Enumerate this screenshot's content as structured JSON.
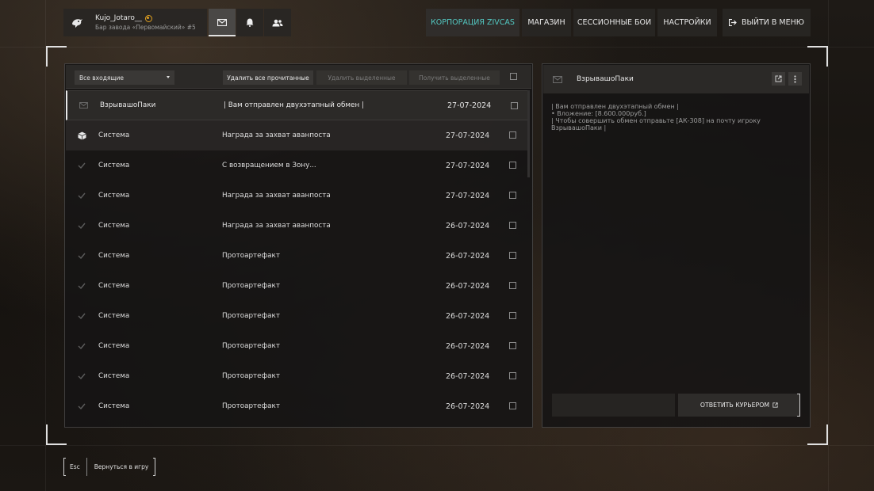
{
  "profile": {
    "name": "Kujo_Jotaro__",
    "subtitle": "Бар завода «Первомайский» #5",
    "avatar_icon": "bird-avatar-icon",
    "badge_icon": "rank-badge-icon",
    "badge_color": "#e0a020"
  },
  "top_icons": [
    {
      "name": "mail-icon",
      "active": true
    },
    {
      "name": "bell-icon",
      "active": false
    },
    {
      "name": "friends-icon",
      "active": false
    }
  ],
  "nav": {
    "corporation": "КОРПОРАЦИЯ ZIVCAS",
    "shop": "МАГАЗИН",
    "session_battles": "СЕССИОННЫЕ БОИ",
    "settings": "НАСТРОЙКИ",
    "exit": "ВЫЙТИ В МЕНЮ"
  },
  "accent_color": "#53c8c2",
  "toolbar": {
    "filter_selected": "Все входящие",
    "delete_read": "Удалить все прочитанные",
    "delete_selected": "Удалить выделенные",
    "receive_selected": "Получить выделенные"
  },
  "messages": [
    {
      "sender": "ВзрывашоПаки",
      "subject": "| Вам отправлен двухэтапный обмен |",
      "date": "27-07-2024",
      "icon": "envelope-icon",
      "state": "selected"
    },
    {
      "sender": "Система",
      "subject": "Награда за захват аванпоста",
      "date": "27-07-2024",
      "icon": "package-icon",
      "state": "unread"
    },
    {
      "sender": "Система",
      "subject": "С возвращением в Зону...",
      "date": "27-07-2024",
      "icon": "check-icon",
      "state": "read"
    },
    {
      "sender": "Система",
      "subject": "Награда за захват аванпоста",
      "date": "27-07-2024",
      "icon": "check-icon",
      "state": "read"
    },
    {
      "sender": "Система",
      "subject": "Награда за захват аванпоста",
      "date": "26-07-2024",
      "icon": "check-icon",
      "state": "read"
    },
    {
      "sender": "Система",
      "subject": "Протоартефакт",
      "date": "26-07-2024",
      "icon": "check-icon",
      "state": "read"
    },
    {
      "sender": "Система",
      "subject": "Протоартефакт",
      "date": "26-07-2024",
      "icon": "check-icon",
      "state": "read"
    },
    {
      "sender": "Система",
      "subject": "Протоартефакт",
      "date": "26-07-2024",
      "icon": "check-icon",
      "state": "read"
    },
    {
      "sender": "Система",
      "subject": "Протоартефакт",
      "date": "26-07-2024",
      "icon": "check-icon",
      "state": "read"
    },
    {
      "sender": "Система",
      "subject": "Протоартефакт",
      "date": "26-07-2024",
      "icon": "check-icon",
      "state": "read"
    },
    {
      "sender": "Система",
      "subject": "Протоартефакт",
      "date": "26-07-2024",
      "icon": "check-icon",
      "state": "read"
    }
  ],
  "reader": {
    "sender": "ВзрывашоПаки",
    "body_lines": [
      "| Вам отправлен двухэтапный обмен |",
      "• Вложение: [8.600.000руб.]",
      "| Чтобы совершить обмен отправьте [АК-308] на почту игроку",
      "ВзрывашоПаки |"
    ],
    "reply_button": "ОТВЕТИТЬ КУРЬЕРОМ"
  },
  "footer": {
    "key": "Esc",
    "action": "Вернуться в игру"
  }
}
